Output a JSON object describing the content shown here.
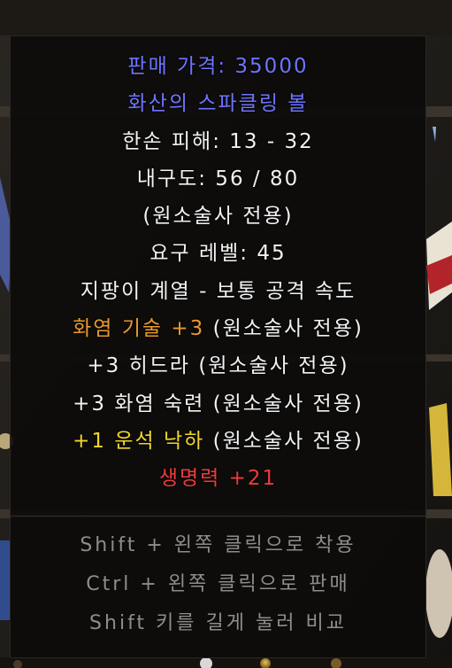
{
  "tooltip": {
    "price": "판매 가격: 35000",
    "item_name": "화산의 스파클링 볼",
    "damage": "한손 피해: 13 - 32",
    "durability": "내구도: 56 / 80",
    "class_only": "(원소술사 전용)",
    "req_level": "요구 레벨: 45",
    "weapon_class": "지팡이 계열 - 보통 공격 속도",
    "mod1_skill": "화염 기술 +3",
    "mod1_class": " (원소술사 전용)",
    "mod2": "+3 히드라 (원소술사 전용)",
    "mod3": "+3 화염 숙련 (원소술사 전용)",
    "mod4_skill": "+1 운석 낙하",
    "mod4_class": " (원소술사 전용)",
    "mod5": "생명력 +21",
    "hint_equip": "Shift + 왼쪽 클릭으로 착용",
    "hint_sell": "Ctrl + 왼쪽 클릭으로 판매",
    "hint_compare": "Shift 키를 길게 눌러 비교"
  },
  "colors": {
    "price": "#6e74ff",
    "item_name": "#6e74ff",
    "base_stats": "#f2f2f2",
    "skill_mod": "#e89a2e",
    "meteor_mod": "#f1d62b",
    "life_mod": "#ef3b3b",
    "hint": "#8d8d8d"
  }
}
